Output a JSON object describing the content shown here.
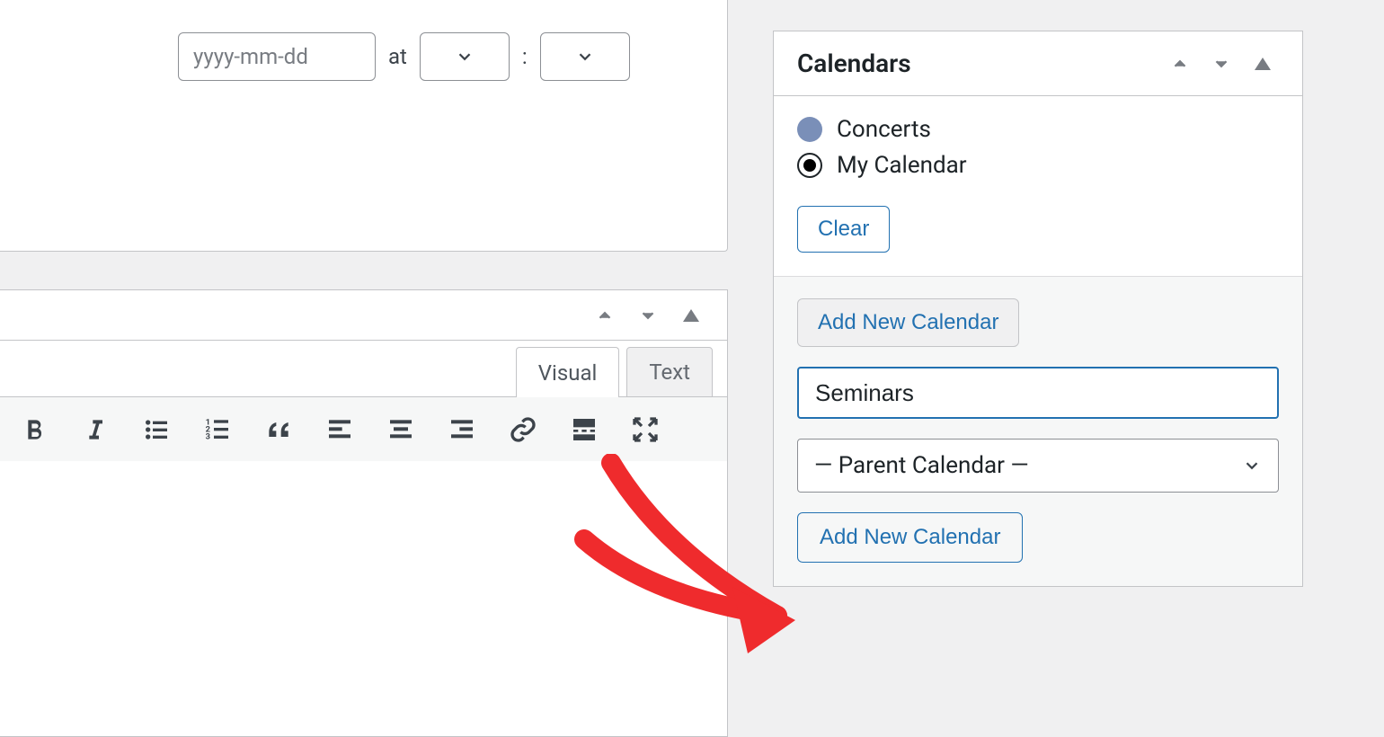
{
  "datetime": {
    "date_placeholder": "yyyy-mm-dd",
    "at_label": "at",
    "colon": ":"
  },
  "editor": {
    "tabs": {
      "visual": "Visual",
      "text": "Text"
    }
  },
  "calendars_panel": {
    "title": "Calendars",
    "items": [
      {
        "label": "Concerts",
        "selected": false,
        "color": "blue"
      },
      {
        "label": "My Calendar",
        "selected": true
      }
    ],
    "clear_label": "Clear",
    "toggle_add_label": "Add New Calendar",
    "name_input_value": "Seminars",
    "parent_select_value": "— Parent Calendar —",
    "add_button_label": "Add New Calendar"
  }
}
